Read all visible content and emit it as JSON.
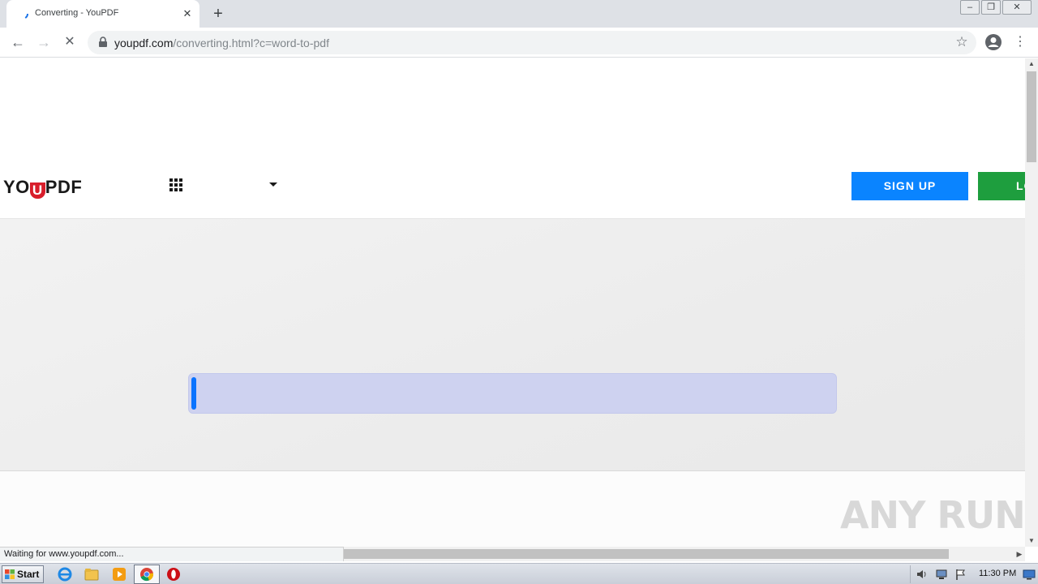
{
  "browser": {
    "tab_title": "Converting - YouPDF",
    "new_tab_label": "+",
    "url_domain": "youpdf.com",
    "url_path": "/converting.html?c=word-to-pdf",
    "status_text": "Waiting for www.youpdf.com..."
  },
  "site": {
    "logo_prefix": "YO",
    "logo_u": "U",
    "logo_suffix": "PDF",
    "signup_label": "SIGN UP",
    "login_label": "LO"
  },
  "progress": {
    "percent": 0.8,
    "accent": "#0a73ff",
    "track": "#ced2f0"
  },
  "watermark": "ANY RUN",
  "taskbar": {
    "start_label": "Start",
    "clock": "11:30 PM"
  },
  "icons": [
    "back-icon",
    "forward-icon",
    "stop-icon",
    "lock-icon",
    "star-icon",
    "account-icon",
    "menu-icon",
    "apps-grid-icon",
    "chevron-down-icon",
    "ie-icon",
    "folder-icon",
    "media-player-icon",
    "chrome-icon",
    "opera-icon",
    "speaker-icon",
    "network-icon",
    "flag-icon",
    "desktop-icon"
  ],
  "colors": {
    "signup": "#0a84ff",
    "login": "#1e9e3e",
    "logo_accent": "#d81e2b"
  }
}
